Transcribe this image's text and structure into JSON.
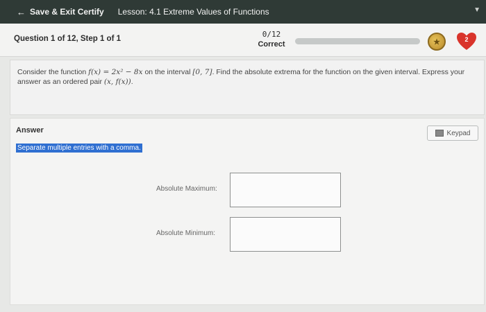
{
  "topbar": {
    "back_label": "Save & Exit Certify",
    "lesson": "Lesson: 4.1 Extreme Values of Functions"
  },
  "header": {
    "question": "Question 1 of 12, Step 1 of 1",
    "score": "0/12",
    "score_label": "Correct",
    "progress": 0,
    "hearts": "2"
  },
  "question": {
    "text_1": "Consider the function ",
    "func": "f(x) = 2x² − 8x",
    "text_2": " on the interval ",
    "interval": "[0, 7]",
    "text_3": ". Find the absolute extrema for the function on the given interval. Express your answer as an ordered pair ",
    "pair": "(x, f(x))",
    "text_4": "."
  },
  "answer": {
    "label": "Answer",
    "keypad": "Keypad",
    "hint": "Separate multiple entries with a comma.",
    "max_label": "Absolute Maximum:",
    "max_value": "",
    "min_label": "Absolute Minimum:",
    "min_value": ""
  },
  "colors": {
    "topbar": "#2f3a36",
    "hint_bg": "#2f6fd1",
    "heart": "#d9342b",
    "coin": "#c9a23f"
  }
}
